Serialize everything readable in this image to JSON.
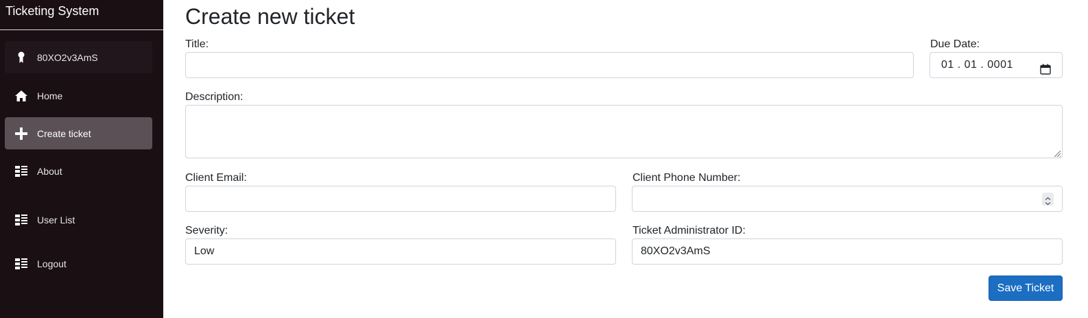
{
  "app": {
    "title": "Ticketing System"
  },
  "sidebar": {
    "user": {
      "label": "80XO2v3AmS",
      "icon": "award-icon"
    },
    "items": [
      {
        "label": "Home",
        "icon": "home-icon"
      },
      {
        "label": "Create ticket",
        "icon": "plus-icon",
        "active": true
      },
      {
        "label": "About",
        "icon": "list-icon"
      },
      {
        "label": "User List",
        "icon": "list-icon"
      },
      {
        "label": "Logout",
        "icon": "list-icon"
      }
    ]
  },
  "form": {
    "heading": "Create new ticket",
    "title": {
      "label": "Title:",
      "value": ""
    },
    "due_date": {
      "label": "Due Date:",
      "value": "01 . 01 . 0001"
    },
    "description": {
      "label": "Description:",
      "value": ""
    },
    "client_email": {
      "label": "Client Email:",
      "value": ""
    },
    "client_phone": {
      "label": "Client Phone Number:",
      "value": ""
    },
    "severity": {
      "label": "Severity:",
      "value": "Low"
    },
    "admin_id": {
      "label": "Ticket Administrator ID:",
      "value": "80XO2v3AmS"
    },
    "save_label": "Save Ticket"
  },
  "colors": {
    "sidebar_bg": "#1a0f13",
    "active_item": "#5b5056",
    "primary_button": "#1b6ec2"
  }
}
